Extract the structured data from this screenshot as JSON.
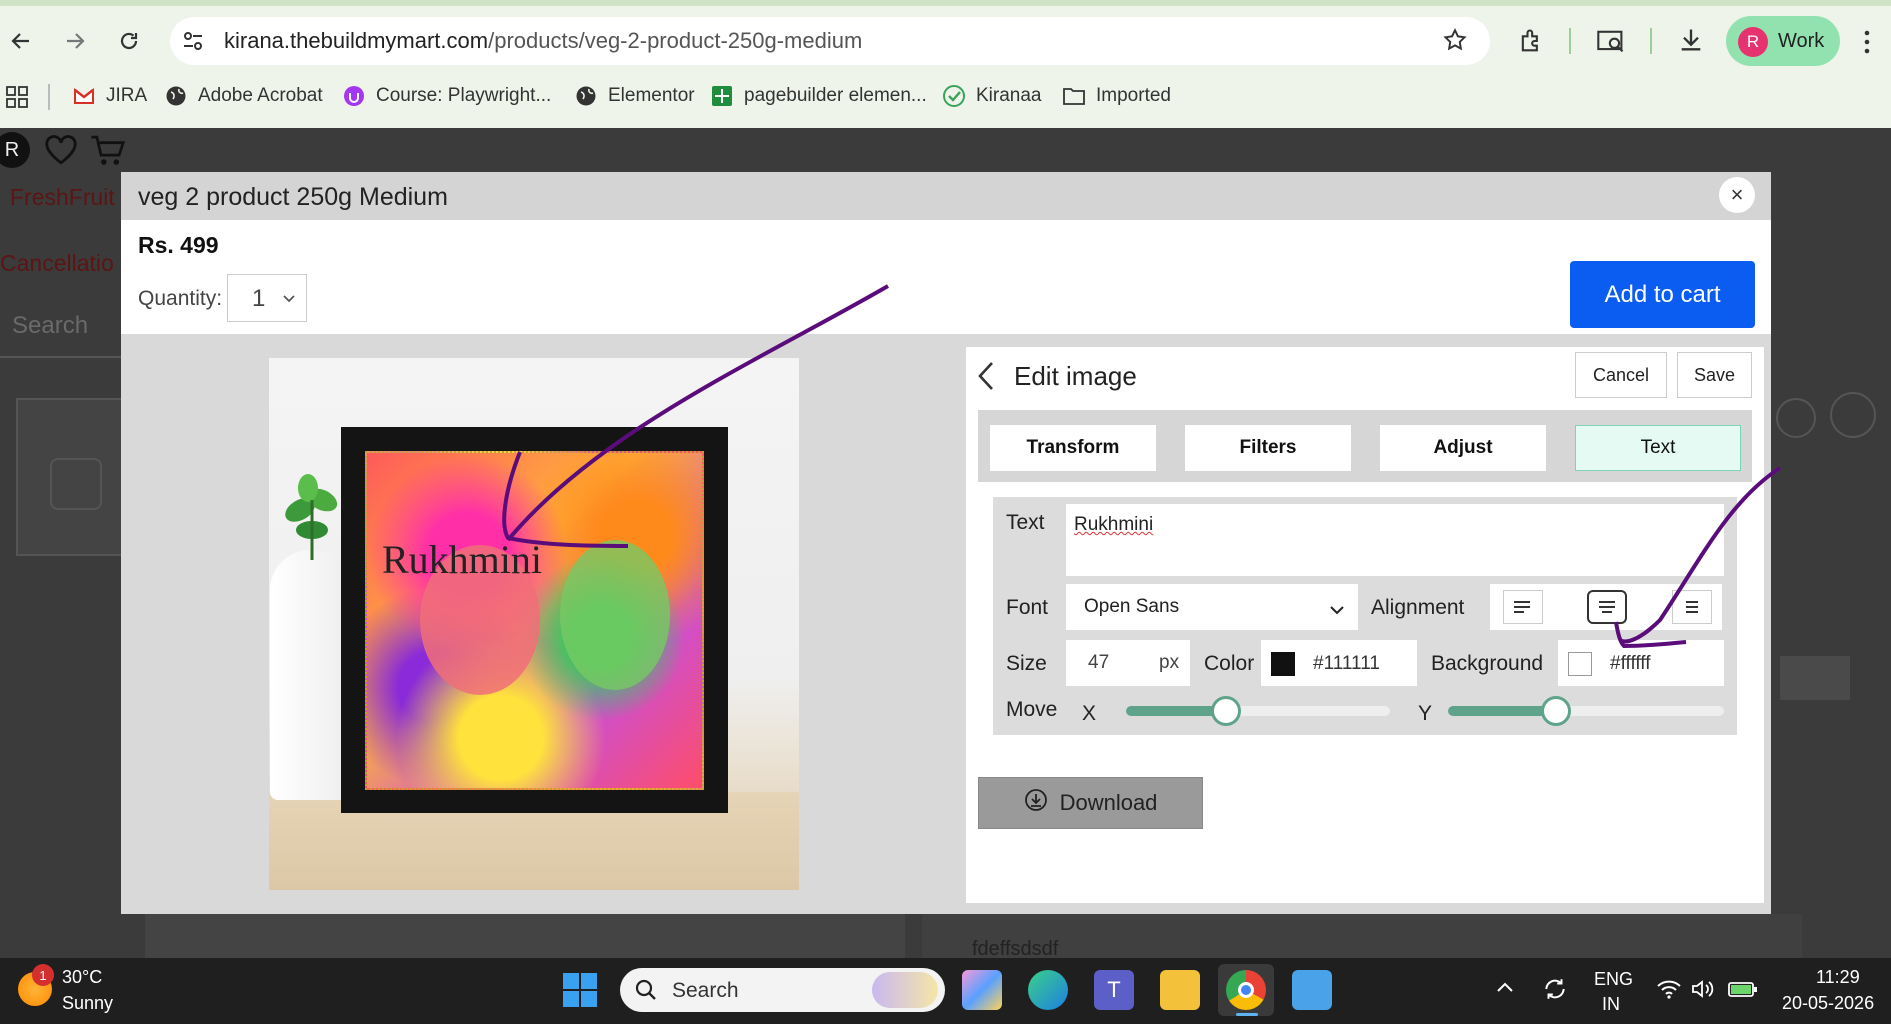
{
  "browser": {
    "url_host": "kirana.thebuildmymart.com",
    "url_path": "/products/veg-2-product-250g-medium",
    "profile_initial": "R",
    "profile_label": "Work",
    "bookmarks": [
      {
        "label": "JIRA",
        "icon": "gmail-icon"
      },
      {
        "label": "Adobe Acrobat",
        "icon": "globe-icon"
      },
      {
        "label": "Course: Playwright...",
        "icon": "course-icon"
      },
      {
        "label": "Elementor",
        "icon": "globe-icon"
      },
      {
        "label": "pagebuilder elemen...",
        "icon": "sheet-icon"
      },
      {
        "label": "Kiranaa",
        "icon": "check-icon"
      },
      {
        "label": "Imported",
        "icon": "folder-icon"
      }
    ]
  },
  "background_page": {
    "avatar_initial": "R",
    "brand": "FreshFruit",
    "cancellation": "Cancellatio",
    "search_placeholder": "Search",
    "footer_text": "fdeffsdsdf"
  },
  "modal": {
    "title": "veg 2 product 250g Medium",
    "close": "×",
    "price": "Rs. 499",
    "quantity_label": "Quantity:",
    "quantity_value": "1",
    "add_to_cart": "Add to cart",
    "preview_overlay_text": "Rukhmini"
  },
  "editor": {
    "title": "Edit image",
    "cancel": "Cancel",
    "save": "Save",
    "tabs": [
      "Transform",
      "Filters",
      "Adjust",
      "Text"
    ],
    "active_tab": "Text",
    "text_label": "Text",
    "text_value": "Rukhmini",
    "font_label": "Font",
    "font_value": "Open Sans",
    "alignment_label": "Alignment",
    "alignment_selected": "center",
    "size_label": "Size",
    "size_value": "47",
    "size_unit": "px",
    "color_label": "Color",
    "color_value": "#111111",
    "background_label": "Background",
    "background_value": "#ffffff",
    "move_label": "Move",
    "x_label": "X",
    "y_label": "Y",
    "x_level": 0.38,
    "y_level": 0.39,
    "download": "Download",
    "accent": "#5fa38a"
  },
  "taskbar": {
    "temperature": "30°C",
    "weather": "Sunny",
    "notification_count": "1",
    "search_placeholder": "Search",
    "language": "ENG",
    "region": "IN",
    "time": "11:29",
    "date": "20-05-2026"
  },
  "annotation_color": "#5a0c7a"
}
